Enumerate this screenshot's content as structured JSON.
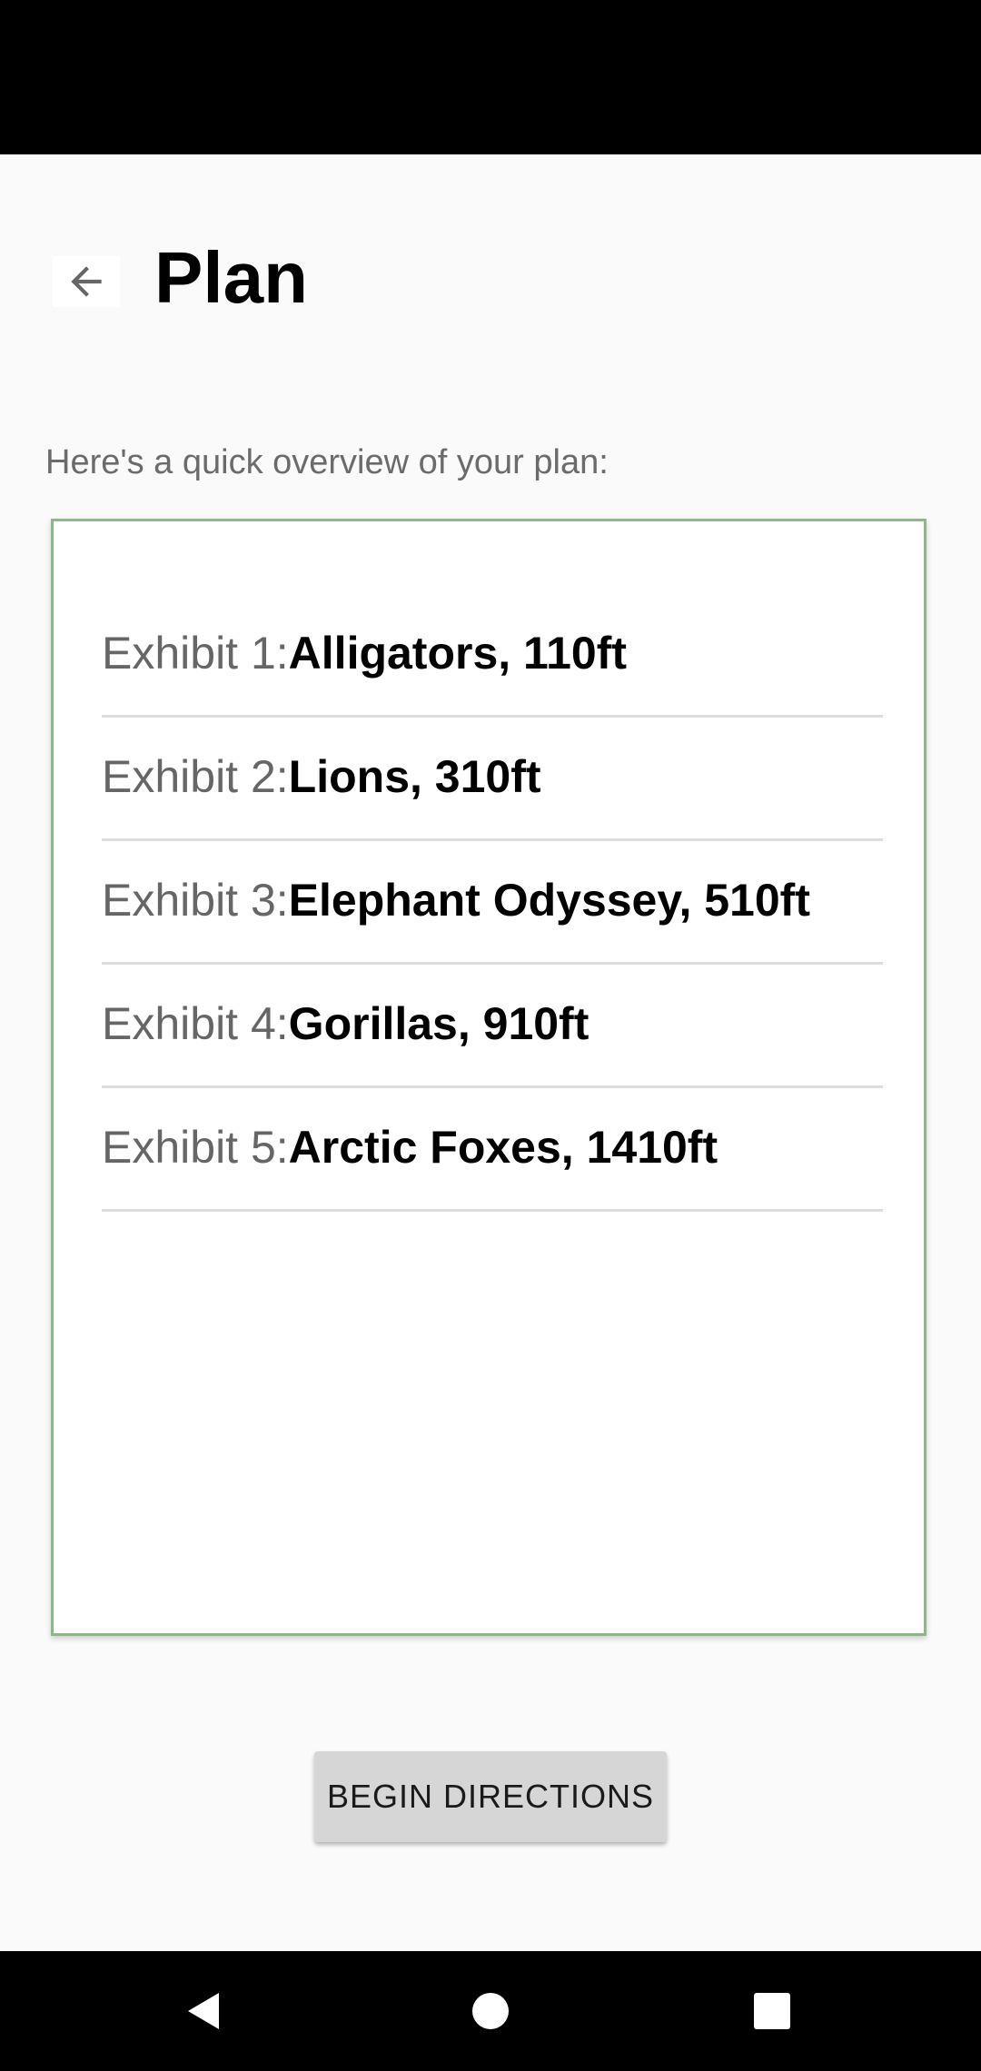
{
  "header": {
    "title": "Plan",
    "back_icon": "arrow-left-icon"
  },
  "subtitle": "Here's a quick overview of your plan:",
  "plan": {
    "border_color": "#8bb886",
    "exhibits": [
      {
        "label": "Exhibit 1: ",
        "value": "Alligators, 110ft"
      },
      {
        "label": "Exhibit 2: ",
        "value": "Lions, 310ft"
      },
      {
        "label": "Exhibit 3: ",
        "value": "Elephant Odyssey, 510ft"
      },
      {
        "label": "Exhibit 4: ",
        "value": "Gorillas, 910ft"
      },
      {
        "label": "Exhibit 5: ",
        "value": "Arctic Foxes, 1410ft"
      }
    ]
  },
  "actions": {
    "begin_label": "BEGIN DIRECTIONS"
  },
  "nav_bar": {
    "icons": [
      "nav-back-icon",
      "nav-home-icon",
      "nav-recents-icon"
    ]
  }
}
